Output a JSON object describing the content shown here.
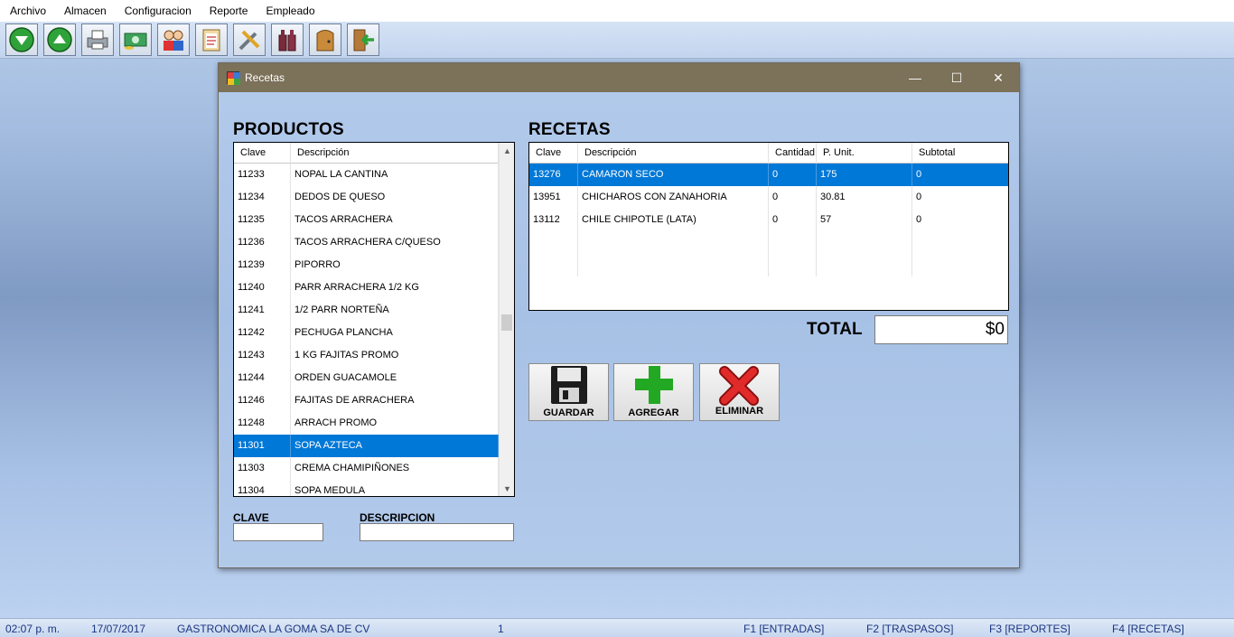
{
  "menu": [
    "Archivo",
    "Almacen",
    "Configuracion",
    "Reporte",
    "Empleado"
  ],
  "toolbar_icons": [
    "download-arrow-icon",
    "upload-arrow-icon",
    "printer-icon",
    "money-icon",
    "users-icon",
    "clipboard-icon",
    "tools-icon",
    "bottles-icon",
    "door-icon",
    "exit-icon"
  ],
  "window": {
    "title": "Recetas",
    "minimize": "—",
    "maximize": "☐",
    "close": "✕"
  },
  "productos": {
    "title": "PRODUCTOS",
    "columns": [
      "Clave",
      "Descripción"
    ],
    "rows": [
      [
        "11233",
        "NOPAL LA CANTINA"
      ],
      [
        "11234",
        "DEDOS DE QUESO"
      ],
      [
        "11235",
        "TACOS ARRACHERA"
      ],
      [
        "11236",
        "TACOS ARRACHERA C/QUESO"
      ],
      [
        "11239",
        "PIPORRO"
      ],
      [
        "11240",
        "PARR ARRACHERA 1/2 KG"
      ],
      [
        "11241",
        "1/2 PARR NORTEÑA"
      ],
      [
        "11242",
        "PECHUGA PLANCHA"
      ],
      [
        "11243",
        "1 KG FAJITAS PROMO"
      ],
      [
        "11244",
        "ORDEN GUACAMOLE"
      ],
      [
        "11246",
        "FAJITAS DE ARRACHERA"
      ],
      [
        "11248",
        "ARRACH PROMO"
      ],
      [
        "11301",
        "SOPA AZTECA"
      ],
      [
        "11303",
        "CREMA CHAMIPIÑONES"
      ],
      [
        "11304",
        "SOPA MEDULA"
      ]
    ],
    "selected_index": 12
  },
  "recetas": {
    "title": "RECETAS",
    "columns": [
      "Clave",
      "Descripción",
      "Cantidad",
      "P. Unit.",
      "Subtotal"
    ],
    "rows": [
      [
        "13276",
        "CAMARON SECO",
        "0",
        "175",
        "0"
      ],
      [
        "13951",
        "CHICHAROS CON ZANAHORIA",
        "0",
        "30.81",
        "0"
      ],
      [
        "13112",
        "CHILE CHIPOTLE (LATA)",
        "0",
        "57",
        "0"
      ]
    ],
    "selected_index": 0
  },
  "filters": {
    "clave_label": "CLAVE",
    "clave_value": "",
    "descripcion_label": "DESCRIPCION",
    "descripcion_value": ""
  },
  "total": {
    "label": "TOTAL",
    "value": "$0"
  },
  "buttons": {
    "guardar": "GUARDAR",
    "agregar": "AGREGAR",
    "eliminar": "ELIMINAR"
  },
  "status": {
    "time": "02:07 p. m.",
    "date": "17/07/2017",
    "company": "GASTRONOMICA LA GOMA SA DE CV",
    "number": "1",
    "f1": "F1 [ENTRADAS]",
    "f2": "F2 [TRASPASOS]",
    "f3": "F3 [REPORTES]",
    "f4": "F4 [RECETAS]"
  },
  "colors": {
    "selection": "#0078d7",
    "titlebar": "#7c7159",
    "status_text": "#1b3580"
  }
}
